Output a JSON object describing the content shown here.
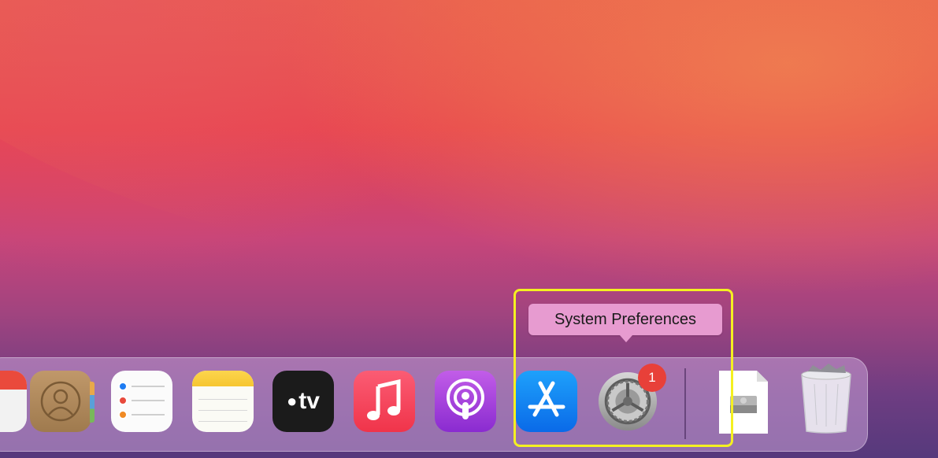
{
  "tooltip": {
    "text": "System Preferences"
  },
  "dock": {
    "apps": [
      {
        "name": "Calendar",
        "icon": "calendar-icon"
      },
      {
        "name": "Contacts",
        "icon": "contacts-icon"
      },
      {
        "name": "Reminders",
        "icon": "reminders-icon"
      },
      {
        "name": "Notes",
        "icon": "notes-icon"
      },
      {
        "name": "TV",
        "icon": "apple-tv-icon",
        "label": "tv"
      },
      {
        "name": "Music",
        "icon": "music-icon"
      },
      {
        "name": "Podcasts",
        "icon": "podcasts-icon"
      },
      {
        "name": "App Store",
        "icon": "app-store-icon"
      },
      {
        "name": "System Preferences",
        "icon": "gear-icon",
        "badge": "1"
      },
      {
        "name": "Document",
        "icon": "disk-image-file-icon"
      },
      {
        "name": "Trash",
        "icon": "trash-icon"
      }
    ]
  },
  "colors": {
    "highlight": "#f4f021",
    "tooltip_bg": "#e79bd0",
    "badge": "#e84039"
  }
}
